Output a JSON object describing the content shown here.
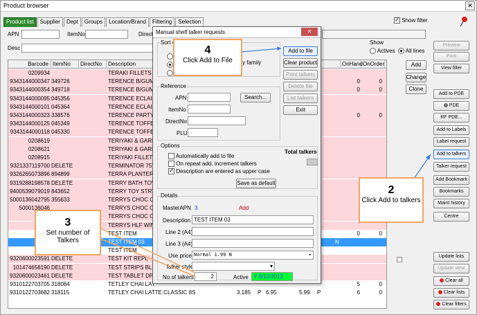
{
  "window": {
    "title": "Product browser"
  },
  "tabs": [
    "Product list",
    "Supplier",
    "Dept",
    "Groups",
    "Location/Brand",
    "Filtering",
    "Selection"
  ],
  "show_filter_label": "Show filter",
  "filters": {
    "apn_label": "APN",
    "itemno_label": "ItemNo",
    "directno_label": "Direct",
    "desc_label": "Desc"
  },
  "show": {
    "label": "Show",
    "actives": "Actives",
    "all_lines": "All lines"
  },
  "grid": {
    "headers": [
      "Barcode",
      "ItemNo",
      "DirectNo",
      "Description",
      "OnHand",
      "OnOrder"
    ],
    "rows": [
      {
        "barcode": "0209934",
        "itemno": "",
        "flag": "",
        "desc": "TERAKI FILLETS",
        "onhand": "",
        "onorder": "",
        "style": "pink"
      },
      {
        "barcode": "9343144000347",
        "itemno": "349726",
        "flag": "",
        "desc": "TERENCE B/GUM",
        "onhand": "0",
        "onorder": "0",
        "style": "pink"
      },
      {
        "barcode": "9343144000354",
        "itemno": "349718",
        "flag": "",
        "desc": "TERENCE B/GUM",
        "onhand": "0",
        "onorder": "0",
        "style": "pink"
      },
      {
        "barcode": "9343144000095",
        "itemno": "045356",
        "flag": "",
        "desc": "TERENCE ECLAIR",
        "onhand": "",
        "onorder": "",
        "style": "pink"
      },
      {
        "barcode": "9343144000101",
        "itemno": "045364",
        "flag": "",
        "desc": "TERENCE ECLAIR",
        "onhand": "",
        "onorder": "",
        "style": "pink"
      },
      {
        "barcode": "9343144000323",
        "itemno": "338576",
        "flag": "",
        "desc": "TERENCE PARTY",
        "onhand": "0",
        "onorder": "0",
        "style": "pink"
      },
      {
        "barcode": "9343144000125",
        "itemno": "045349",
        "flag": "",
        "desc": "TERENCE TOFFEE",
        "onhand": "",
        "onorder": "",
        "style": "pink"
      },
      {
        "barcode": "9343144000118",
        "itemno": "045330",
        "flag": "",
        "desc": "TERENCE TOFFEE",
        "onhand": "",
        "onorder": "",
        "style": "pink"
      },
      {
        "barcode": "0208619",
        "itemno": "",
        "flag": "",
        "desc": "TERIYAKI & GARLI",
        "onhand": "",
        "onorder": "",
        "style": "pink"
      },
      {
        "barcode": "0208621",
        "itemno": "",
        "flag": "",
        "desc": "TERIYAKI & GARLI",
        "onhand": "",
        "onorder": "",
        "style": "pink"
      },
      {
        "barcode": "0208915",
        "itemno": "",
        "flag": "",
        "desc": "TERIYAKI FILLET",
        "onhand": "",
        "onorder": "",
        "style": "pink"
      },
      {
        "barcode": "9321337119700",
        "itemno": "DELETE",
        "flag": "",
        "desc": "TERMINATOR 75T",
        "onhand": "",
        "onorder": "",
        "style": "pink"
      },
      {
        "barcode": "9326265073896",
        "itemno": "894899",
        "flag": "",
        "desc": "TERRA PLANTER",
        "onhand": "",
        "onorder": "",
        "style": "pink"
      },
      {
        "barcode": "9319288198578",
        "itemno": "DELETE",
        "flag": "",
        "desc": "TERRY BATH TOV",
        "onhand": "",
        "onorder": "",
        "style": "pink"
      },
      {
        "barcode": "9400539079019",
        "itemno": "843652",
        "flag": "",
        "desc": "TERRY TOY STRV",
        "onhand": "",
        "onorder": "",
        "style": "pink"
      },
      {
        "barcode": "5000136042795",
        "itemno": "355633",
        "flag": "",
        "desc": "TERRYS CHOC OR",
        "onhand": "",
        "onorder": "",
        "style": "pink"
      },
      {
        "barcode": "5000136046",
        "itemno": "",
        "flag": "",
        "desc": "TERRYS CHOC OR",
        "onhand": "",
        "onorder": "",
        "style": "pink"
      },
      {
        "barcode": "",
        "itemno": "",
        "flag": "",
        "desc": "TERRYS CHOC OR",
        "onhand": "",
        "onorder": "",
        "style": "pink"
      },
      {
        "barcode": "",
        "itemno": "",
        "flag": "",
        "desc": "TERRYS HLF WIN",
        "onhand": "",
        "onorder": "",
        "style": "pink"
      },
      {
        "barcode": "",
        "itemno": "",
        "flag": "",
        "desc": "TEST ITEM",
        "onhand": "0",
        "onorder": "0",
        "style": "white"
      },
      {
        "barcode": "",
        "itemno": "",
        "flag": "N",
        "desc": "TEST ITEM 03",
        "onhand": "",
        "onorder": "",
        "style": "sel"
      },
      {
        "barcode": "",
        "itemno": "",
        "flag": "",
        "desc": "TEST ITEM",
        "onhand": "",
        "onorder": "",
        "style": "white"
      },
      {
        "barcode": "9320600023591",
        "itemno": "DELETE",
        "flag": "",
        "desc": "TEST KIT REPL",
        "onhand": "",
        "onorder": "",
        "style": "pink"
      },
      {
        "barcode": "101474658190",
        "itemno": "DELETE",
        "flag": "",
        "desc": "TEST STRIPS BL",
        "onhand": "",
        "onorder": "",
        "style": "pink"
      },
      {
        "barcode": "9320600023461",
        "itemno": "DELETE",
        "flag": "",
        "desc": "TEST TABLET DP",
        "onhand": "",
        "onorder": "",
        "style": "pink"
      },
      {
        "barcode": "9310122703705",
        "itemno": "318084",
        "flag": "",
        "desc": "TETLEY CHAI LAT",
        "onhand": "5",
        "onorder": "0",
        "style": "white"
      },
      {
        "barcode": "9310122703682",
        "itemno": "318115",
        "flag": "",
        "desc": "TETLEY CHAI LATTE CLASSIC  8S",
        "onhand": "6",
        "onorder": "0",
        "style": "white"
      }
    ],
    "last_row_extra": {
      "price1": "3.185",
      "p1": "P",
      "price2": "6.95",
      "price3": "5.99",
      "p2": "P"
    }
  },
  "side_buttons": [
    "Add",
    "Change",
    "Clone"
  ],
  "right_buttons": [
    "Preview",
    "Print",
    "View filter",
    "Add to PDE",
    "PDE",
    "RF PDE...",
    "Add to Labels",
    "Label request",
    "Add to talkers",
    "Talker request",
    "Add Bookmark",
    "Bookmarks",
    "Maint history",
    "Centre",
    "Update lists",
    "Update view",
    "Clear all",
    "Clear lists",
    "Clear filters"
  ],
  "dialog": {
    "title": "Manual shelf talker requests",
    "sort_label": "Sort o",
    "sort_by_family": "o by family",
    "buttons": [
      "Add to file",
      "Clear product",
      "Print talkers",
      "Delete file",
      "List talkers",
      "Exit"
    ],
    "reference_label": "Reference",
    "ref_apn": "APN",
    "ref_itemno": "ItemNo",
    "ref_directno": "DirectNo",
    "ref_plu": "PLU",
    "search_button": "Search...",
    "options_label": "Options",
    "opt1": "Automatically add to file",
    "opt2": "On repeat add, increment talkers",
    "opt3": "Description are entered as upper case",
    "total_talkers": "Total talkers",
    "save_default": "Save as default",
    "details_label": "Details",
    "masterapn_label": "MasterAPN",
    "masterapn_value": "3",
    "add_link": "Add",
    "description_label": "Description",
    "description_value": "TEST ITEM 03",
    "line2_label": "Line 2 (A4)",
    "line3_label": "Line 3 (A4)",
    "use_price_label": "Use price",
    "use_price_value": "Normal          1.99 N",
    "talker_style_label": "Talker style",
    "no_talkers_label": "No of talkers",
    "no_talkers_value": "2",
    "active_label": "Active",
    "active_value": "Y 6/12/2012"
  },
  "callouts": {
    "c4_num": "4",
    "c4_text": "Click Add to File",
    "c2_num": "2",
    "c2_text": "Click Add to talkers",
    "c3_num": "3",
    "c3_text": "Set number of Talkers"
  },
  "colors": {
    "accent": "#2e8b2e",
    "callout_border": "#f4a460",
    "pink_row": "#fcd7dc",
    "selected_row": "#3399ff",
    "active_green": "#00ff33"
  }
}
